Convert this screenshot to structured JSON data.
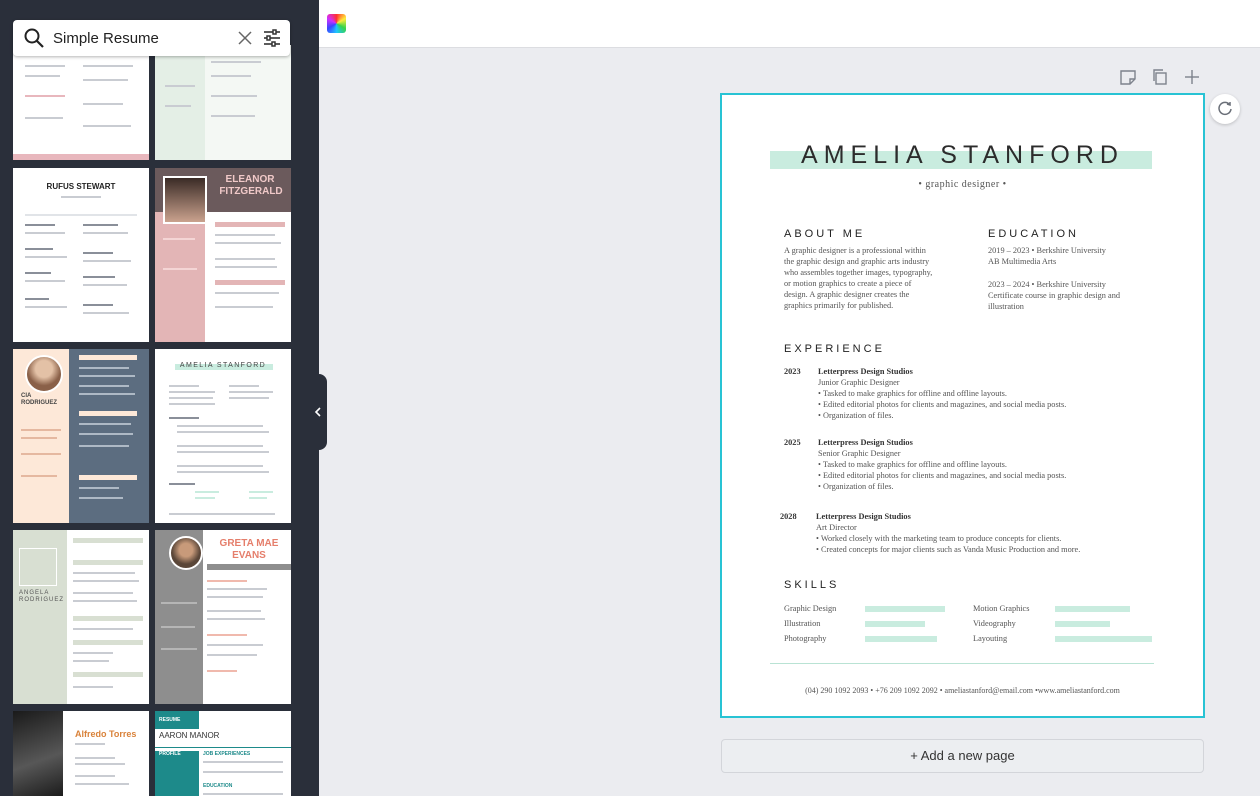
{
  "search": {
    "value": "Simple Resume",
    "icon": "search-icon",
    "clear_icon": "close-icon",
    "filter_icon": "filter-sliders-icon"
  },
  "templates": {
    "rufus_name": "RUFUS STEWART",
    "eleanor_name_line1": "ELEANOR",
    "eleanor_name_line2": "FITZGERALD",
    "cia_name_line1": "CIA",
    "cia_name_line2": "RODRIGUEZ",
    "amelia_name": "AMELIA STANFORD",
    "angela_name_line1": "ANGELA",
    "angela_name_line2": "RODRIGUEZ",
    "greta_name_line1": "GRETA MAE",
    "greta_name_line2": "EVANS",
    "alfredo_name": "Alfredo Torres",
    "aaron_label": "RESUME",
    "aaron_name": "AARON MANOR",
    "aaron_profile": "PROFILE",
    "aaron_job": "JOB EXPERIENCES",
    "aaron_edu": "EDUCATION"
  },
  "collapse_icon": "chevron-left-icon",
  "toolbar": {
    "color_icon": "color-picker-icon"
  },
  "page_tools": {
    "note_icon": "note-icon",
    "duplicate_icon": "copy-icon",
    "add_icon": "plus-icon",
    "refresh_icon": "refresh-icon"
  },
  "resume": {
    "name": "AMELIA STANFORD",
    "role": "• graphic designer •",
    "about_heading": "ABOUT ME",
    "about_lines": [
      "A graphic designer is a professional within",
      "the graphic design and graphic arts industry",
      "who assembles together images, typography,",
      "or motion graphics to create a piece of",
      "design. A graphic designer creates the",
      "graphics primarily for published."
    ],
    "education_heading": "EDUCATION",
    "education": [
      {
        "line1": "2019 – 2023 • Berkshire University",
        "line2": "AB Multimedia Arts",
        "line3": ""
      },
      {
        "line1": "2023 – 2024 • Berkshire University",
        "line2": "Certificate course in graphic design and",
        "line3": "illustration"
      }
    ],
    "experience_heading": "EXPERIENCE",
    "experience": [
      {
        "year": "2023",
        "company": "Letterpress Design Studios",
        "title": "Junior Graphic Designer",
        "bullets": [
          "• Tasked to make graphics for offline and offline layouts.",
          "• Edited editorial photos for clients and magazines, and social media posts.",
          "• Organization of files."
        ]
      },
      {
        "year": "2025",
        "company": "Letterpress Design Studios",
        "title": "Senior Graphic Designer",
        "bullets": [
          "• Tasked to make graphics for offline and offline layouts.",
          "• Edited editorial photos for clients and magazines, and social media posts.",
          "• Organization of files."
        ]
      },
      {
        "year": "2028",
        "company": "Letterpress Design Studios",
        "title": "Art Director",
        "bullets": [
          "• Worked closely with the marketing team to produce concepts for clients.",
          "• Created concepts for major clients such as Vanda Music Production and more."
        ]
      }
    ],
    "skills_heading": "SKILLS",
    "skills": [
      {
        "name": "Graphic Design",
        "level": 0.82
      },
      {
        "name": "Illustration",
        "level": 0.62
      },
      {
        "name": "Photography",
        "level": 0.74
      },
      {
        "name": "Motion Graphics",
        "level": 0.77
      },
      {
        "name": "Videography",
        "level": 0.57
      },
      {
        "name": "Layouting",
        "level": 1.0
      }
    ],
    "contact": "(04) 290 1092 2093 • +76 209 1092 2092 • ameliastanford@email.com •www.ameliastanford.com"
  },
  "add_page_label": "+ Add a new page",
  "colors": {
    "accent": "#28c3d4",
    "mint": "#c9ecdf",
    "panel": "#2a2f3a"
  }
}
